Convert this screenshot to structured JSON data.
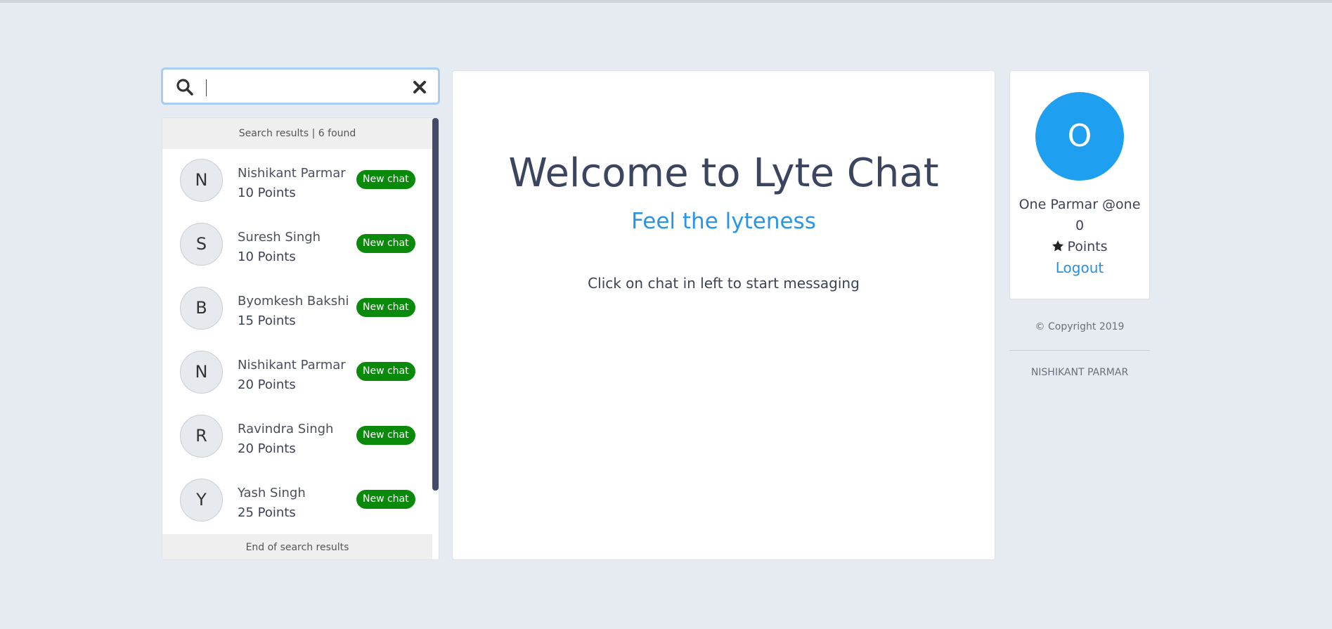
{
  "search": {
    "value": "",
    "placeholder": ""
  },
  "results": {
    "header": "Search results | 6 found",
    "footer": "End of search results",
    "items": [
      {
        "initial": "N",
        "name": "Nishikant Parmar",
        "points": "10 Points",
        "action": "New chat"
      },
      {
        "initial": "S",
        "name": "Suresh Singh",
        "points": "10 Points",
        "action": "New chat"
      },
      {
        "initial": "B",
        "name": "Byomkesh Bakshi",
        "points": "15 Points",
        "action": "New chat"
      },
      {
        "initial": "N",
        "name": "Nishikant Parmar",
        "points": "20 Points",
        "action": "New chat"
      },
      {
        "initial": "R",
        "name": "Ravindra Singh",
        "points": "20 Points",
        "action": "New chat"
      },
      {
        "initial": "Y",
        "name": "Yash Singh",
        "points": "25 Points",
        "action": "New chat"
      }
    ]
  },
  "main": {
    "title": "Welcome to Lyte Chat",
    "subtitle": "Feel the lyteness",
    "hint": "Click on chat in left to start messaging"
  },
  "profile": {
    "initial": "O",
    "name_line": "One Parmar @one",
    "points_value": "0",
    "points_label": "Points",
    "logout": "Logout"
  },
  "footer": {
    "copyright": "© Copyright 2019",
    "author": "NISHIKANT PARMAR"
  },
  "colors": {
    "background": "#e5ebf0",
    "accent": "#2a95e8",
    "avatar": "#1f9fef",
    "new_chat_badge": "#0a8a0a",
    "scrollbar": "#444b66"
  },
  "icons": {
    "search": "search-icon",
    "clear": "close-icon",
    "star": "star-icon"
  }
}
